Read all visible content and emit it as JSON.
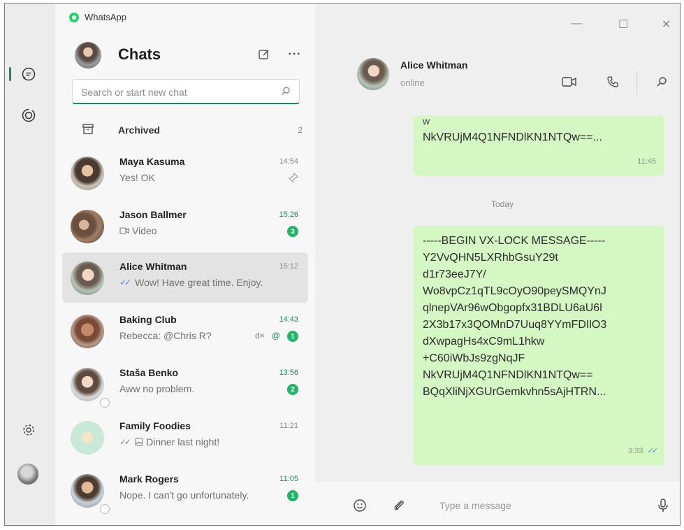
{
  "app": {
    "title": "WhatsApp"
  },
  "window_controls": {
    "minimize": "—",
    "maximize": "☐",
    "close": "✕"
  },
  "list": {
    "title": "Chats",
    "search_placeholder": "Search or start new chat",
    "archived": {
      "label": "Archived",
      "count": "2"
    },
    "chats": [
      {
        "name": "Maya Kasuma",
        "time": "14:54",
        "preview": "Yes! OK",
        "time_green": false,
        "pinned": true
      },
      {
        "name": "Jason Ballmer",
        "time": "15:26",
        "preview": "Video",
        "time_green": true,
        "badge": "3"
      },
      {
        "name": "Alice Whitman",
        "time": "15:12",
        "preview": "Wow! Have great time. Enjoy.",
        "time_green": false,
        "selected": true,
        "ticks": "blue"
      },
      {
        "name": "Baking Club",
        "time": "14:43",
        "preview": "Rebecca: @Chris R?",
        "time_green": true,
        "badge": "1",
        "muted": true,
        "mention": "@"
      },
      {
        "name": "Staša Benko",
        "time": "13:56",
        "preview": "Aww no problem.",
        "time_green": true,
        "badge": "2"
      },
      {
        "name": "Family Foodies",
        "time": "11:21",
        "preview": "Dinner last night!",
        "time_green": false,
        "ticks": "grey"
      },
      {
        "name": "Mark Rogers",
        "time": "11:05",
        "preview": "Nope. I can't go unfortunately.",
        "time_green": true,
        "badge": "1"
      }
    ]
  },
  "conversation": {
    "contact_name": "Alice Whitman",
    "contact_status": "online",
    "day_separator": "Today",
    "messages": [
      {
        "lines": [
          "w",
          "NkVRUjM4Q1NFNDlKN1NTQw==..."
        ],
        "time": "11:45"
      },
      {
        "lines": [
          "-----BEGIN VX-LOCK MESSAGE-----",
          "Y2VvQHN5LXRhbGsuY29t",
          "d1r73eeJ7Y/",
          "Wo8vpCz1qTL9cOyO90peySMQYnJ",
          "qlnepVAr96wObgopfx31BDLU6aU6l",
          "2X3b17x3QOMnD7Uuq8YYmFDIlO3",
          "dXwpagHs4xC9mL1hkw",
          "+C60iWbJs9zgNqJF",
          "NkVRUjM4Q1NFNDlKN1NTQw==",
          "BQqXliNjXGUrGemkvhn5sAjHTRN..."
        ],
        "time": "3:33"
      }
    ],
    "composer_placeholder": "Type a message"
  },
  "colors": {
    "accent": "#1b8a5a",
    "bubble": "#d5f7c4",
    "badge": "#25b36a",
    "read_ticks": "#4a90d9"
  }
}
